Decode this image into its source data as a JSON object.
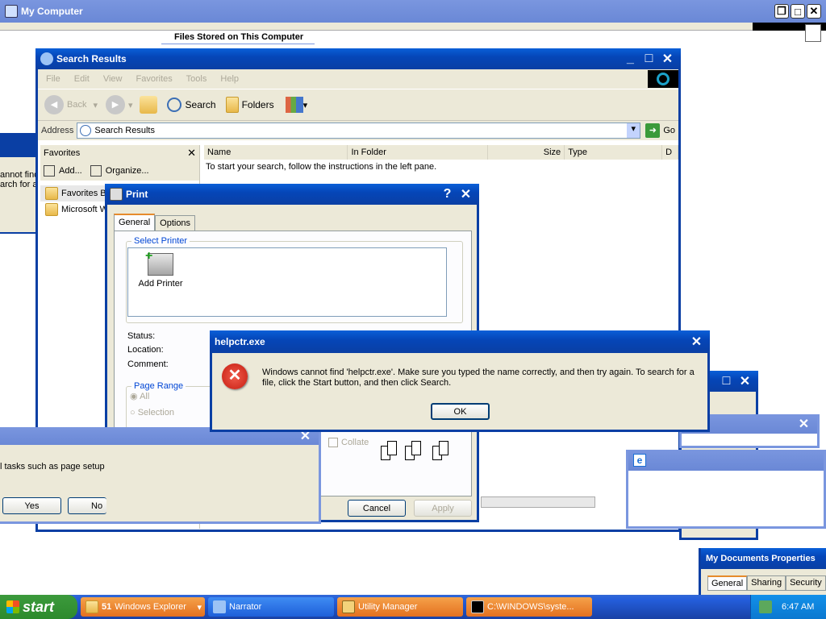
{
  "my_computer": {
    "title": "My Computer",
    "section_heading": "Files Stored on This Computer"
  },
  "search_results": {
    "title": "Search Results",
    "menu": [
      "File",
      "Edit",
      "View",
      "Favorites",
      "Tools",
      "Help"
    ],
    "toolbar": {
      "back": "Back",
      "search": "Search",
      "folders": "Folders"
    },
    "address_label": "Address",
    "address_value": "Search Results",
    "go_label": "Go",
    "favorites_pane": {
      "title": "Favorites",
      "add": "Add...",
      "organize": "Organize...",
      "items": [
        "Favorites Ba",
        "Microsoft W"
      ]
    },
    "columns": [
      "Name",
      "In Folder",
      "Size",
      "Type",
      "D"
    ],
    "hint": "To start your search, follow the instructions in the left pane."
  },
  "left_partial": {
    "line1": "annot find",
    "line2": "arch for a"
  },
  "print_dialog": {
    "title": "Print",
    "tabs": [
      "General",
      "Options"
    ],
    "select_printer": "Select Printer",
    "add_printer": "Add Printer",
    "status": "Status:",
    "location": "Location:",
    "comment": "Comment:",
    "page_range": "Page Range",
    "all": "All",
    "selection": "Selection",
    "collate": "Collate",
    "cancel": "Cancel",
    "apply": "Apply"
  },
  "error_dialog": {
    "title": "helpctr.exe",
    "message": "Windows cannot find 'helpctr.exe'. Make sure you typed the name correctly, and then try again. To search for a file, click the Start button, and then click Search.",
    "ok": "OK"
  },
  "yesno_dialog": {
    "text": "l tasks such as page setup c",
    "yes": "Yes",
    "no": "No"
  },
  "my_docs_props": {
    "title": "My Documents Properties",
    "tabs": [
      "General",
      "Sharing",
      "Security"
    ]
  },
  "taskbar": {
    "start": "start",
    "items": [
      {
        "count": "51",
        "label": "Windows Explorer"
      },
      {
        "label": "Narrator"
      },
      {
        "label": "Utility Manager"
      },
      {
        "label": "C:\\WINDOWS\\syste..."
      }
    ],
    "clock": "6:47 AM"
  }
}
